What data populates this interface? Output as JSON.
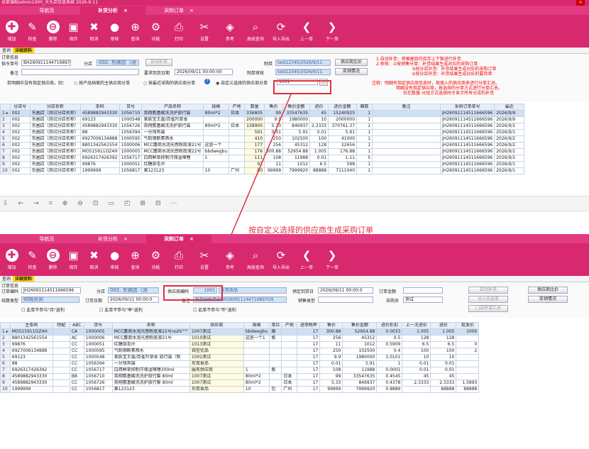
{
  "top": {
    "title": "总部课程admin1000_大头店信息系统 2026-9-11",
    "tabs": [
      {
        "label": "导航页"
      },
      {
        "label": "补货分析"
      },
      {
        "label": "采购订单"
      }
    ],
    "toolbar": [
      "增加",
      "检查",
      "删除",
      "保存",
      "取消",
      "审核",
      "查询",
      "功能",
      "打印",
      "设置",
      "参考",
      "高级查询",
      "导入导出",
      "上一单",
      "下一单"
    ],
    "subtabs": [
      "查询",
      "详细资料"
    ],
    "section": "订单信息",
    "order_no_label": "指令单号",
    "order_no": "BH260911144716897O9",
    "branch_label": "分店",
    "branch": "002. 东圃店（测",
    "auto_btn": "自动补货",
    "maker_label": "制单",
    "maker": "test12345/2026/9/11",
    "compare_btn": "供应商比价",
    "remark_label": "备注",
    "due_label": "要求到货日期",
    "due": "2026/09/11 00:00:00",
    "auditor_label": "制单审核",
    "auditor": "test12345/2026/9/11",
    "stock_btn": "库销情况",
    "question": "若明细中没有指定供应商，则：",
    "opt1": "按产品档案的主供应商分单",
    "opt2": "按最近采购的供应商分单",
    "opt3": "自定义选择的供应商分单",
    "supplier_code": "1001",
    "notes": [
      "1.自动补货：将根据目的库存上下限进行补货",
      "2.审核：①按销售分单：补货结果生成对应的采购订单",
      "③按分店补货：补货结果生成对应的采购订单",
      "④按分店补货：补货结果生成对应的要货单"
    ],
    "notes2": [
      "注释：明细有指定供应商信息时，按填入的供应商来进行分单汇总。",
      "明细没有指定供应商，按选择的分单方式进行分单汇总。",
      "仅在数量-分组方式选择时才显示所有分店的补货"
    ],
    "columns": [
      "分店号",
      "分店名称",
      "条码",
      "货号",
      "产品名称",
      "规格",
      "产地",
      "数量",
      "售价",
      "售价金额",
      "进价",
      "进价金额",
      "箱数",
      "备注",
      "采购订单单号",
      "最近"
    ],
    "rows": [
      [
        "002",
        "东圃店（测试分店名称）",
        "4589882943330",
        "1056710",
        "英翔氨基酸洗洗护旅行装",
        "80ml*2",
        "日本",
        "336805",
        "99",
        "33547635",
        "45",
        "15240925",
        "1",
        "",
        "JH260911145116665​96",
        "2026/9/9"
      ],
      [
        "002",
        "东圃店（测试分店名称）",
        "69123",
        "1000548",
        "美肤宝王露/百雀羚草本",
        "",
        "",
        "200000",
        "9.9",
        "1980000",
        "10",
        "2000000",
        "1",
        "",
        "JH260911145116665​96",
        "2026/9/9"
      ],
      [
        "002",
        "东圃店（测试分店名称）",
        "4589882943330",
        "1056726",
        "英翔氨基酸洗洗护旅行装",
        "80ml*2",
        "日本",
        "158900",
        "5.33",
        "846937",
        "2.3333",
        "370761.37",
        "1",
        "",
        "JH260911145116665​96",
        "2026/9/1"
      ],
      [
        "002",
        "东圃店（测试分店名称）",
        "88",
        "1056394",
        "一分钱有属",
        "",
        "",
        "591",
        "0.01",
        "5.91",
        "0.01",
        "5.91",
        "1",
        "",
        "JH260911145116665​96",
        "2026/9/1"
      ],
      [
        "002",
        "东圃店（测试分店名称）",
        "6927006134888",
        "1000595",
        "气韵钢断素燕水",
        "",
        "",
        "410",
        "250",
        "102500",
        "100",
        "41000",
        "1",
        "",
        "JH260911145116665​96",
        "2026/9/2"
      ],
      [
        "002",
        "东圃店（测试分店名称）",
        "8801342561554",
        "1000006",
        "MCC麋商水润光感粉底液21号",
        "这是一个",
        "",
        "177",
        "256",
        "45312",
        "128",
        "22656",
        "1",
        "",
        "JH260911145116665​96",
        "2026/9/2"
      ],
      [
        "002",
        "东圃店（测试分店名称）",
        "MO515911OZ4H",
        "1000005",
        "MCC麋商水润光感粉底液22号",
        "bbdwegbu",
        "",
        "176",
        "300.88",
        "52954.88",
        "1.005",
        "176.88",
        "1",
        "",
        "JH260911145116665​96",
        "2026/9/1"
      ],
      [
        "002",
        "东圃店（测试分店名称）",
        "6926317426392",
        "1056717",
        "白西鲜草抑制汗保湿啫喱",
        "1",
        "",
        "111",
        "108",
        "11988",
        "0.01",
        "1.11",
        "5",
        "",
        "JH260911145116665​96",
        "2026/9/1"
      ],
      [
        "002",
        "东圃店（测试分店名称）",
        "99876",
        "1000051",
        "红糖蒜毛巾",
        "",
        "",
        "92",
        "11",
        "1012",
        "6.5",
        "598",
        "1",
        "",
        "JH260911145116665​96",
        "2026/9/1"
      ],
      [
        "002",
        "东圃店（测试分店名称）",
        "1999999",
        "1056817",
        "果123123",
        "10",
        "广州",
        "80",
        "99999",
        "7999920",
        "88888",
        "7111040",
        "1",
        "",
        "JH260911145116665​96",
        "2026/9/1"
      ]
    ],
    "midbar": [
      "⇩",
      "←",
      "→",
      "⌗",
      "⊕",
      "⊖",
      "⊡",
      "▭",
      "◰",
      "⊞",
      "⊟",
      "⋯"
    ],
    "caption": "按自定义选择的供应商生成采购订单"
  },
  "bottom": {
    "tabs": [
      {
        "label": "导航页"
      },
      {
        "label": "补货分析"
      },
      {
        "label": "采购订单"
      }
    ],
    "subtabs": [
      "查询",
      "详细资料"
    ],
    "section": "订单信息",
    "po_label": "订单编码",
    "po": "JH2609111451166659​6",
    "branch_label": "分店",
    "branch": "002. 东圃店（测",
    "sup_label": "供应商编码",
    "sup_code": "1001",
    "sup_name": "东莞食品",
    "arrive_label": "预定到货日",
    "arrive": "2026/09/11 00:00:0",
    "amount_label": "订单金额",
    "auto_btn": "自动补货",
    "compare_btn": "供应商比价",
    "settle_label": "结算类型",
    "settle": "购销货到",
    "date_label": "订货日期",
    "date": "2026/09/11 00:00:0",
    "remark_label": "备注",
    "remark": "补货分析单号BH260911144716897O9",
    "saletype_label": "销售类型",
    "buyer_label": "采购员",
    "buyer": "测试",
    "import_btn": "导入托运单",
    "stock_btn": "库销情况",
    "sum_btn": "门店申请汇总",
    "chk1": "此单不参与\"月\"返利",
    "chk2": "此单不参与\"季\"返利",
    "chk3": "此单不参与\"年\"返利",
    "columns": [
      "主条码",
      "特配",
      "ABC",
      "货号",
      "名称",
      "供应商",
      "规格",
      "单位",
      "产地",
      "进项税率",
      "售价",
      "售价金额",
      "进价折扣",
      "上一次进价",
      "进价",
      "批发价"
    ],
    "rows": [
      [
        "MO515911OZ4H",
        "",
        "CA",
        "1000005",
        "MCC麋商水润光感粉底液22号rezhi\"\"\"",
        "1007测试",
        "bbdwegbu",
        "箱",
        "",
        "17",
        "300.88",
        "52954.88",
        "0.0033",
        "1.005",
        "1.005",
        "1000"
      ],
      [
        "8801342561554",
        "",
        "AC",
        "1000006",
        "MCC麋商水润光感粉底液21号",
        "1010测试",
        "这是一个1",
        "瓶",
        "",
        "17",
        "256",
        "45312",
        "0.5",
        "128",
        "128",
        ""
      ],
      [
        "99876",
        "",
        "CC",
        "1000051",
        "红糖蒜毛巾",
        "1013测试",
        "",
        "",
        "",
        "17",
        "11",
        "1012",
        "0.5909",
        "6.5",
        "6.5",
        "0"
      ],
      [
        "6927006134888",
        "",
        "CC",
        "1000595",
        "气韵钢断素燕水",
        "钼宜优品",
        "",
        "",
        "",
        "17",
        "250",
        "102500",
        "0.4",
        "100",
        "100",
        "2"
      ],
      [
        "69123",
        "",
        "CC",
        "1000548",
        "美肤宝王露/百雀羚草本 旅行装（新",
        "1002测试",
        "",
        "",
        "",
        "17",
        "9.9",
        "1980000",
        "1.0101",
        "10",
        "10",
        ""
      ],
      [
        "88",
        "",
        "CC",
        "1056394",
        "一分钱有属",
        "东莞食品",
        "",
        "",
        "",
        "17",
        "0.01",
        "5.91",
        "1",
        "0.01",
        "0.01",
        ""
      ],
      [
        "6926317426392",
        "",
        "CC",
        "1056717",
        "白西鲜草抑制汗保湿啫喱300ml",
        "服务供应商",
        "1",
        "瓶",
        "",
        "17",
        "108",
        "11988",
        "0.0001",
        "0.01",
        "0.01",
        ""
      ],
      [
        "4589882943330",
        "",
        "BB",
        "1056710",
        "英翔氨基酸洗洗护旅行套 80ml",
        "1007测试",
        "80ml*2",
        "",
        "日本",
        "17",
        "99",
        "33547635",
        "0.4545",
        "45",
        "45",
        ""
      ],
      [
        "4589882943330",
        "",
        "CC",
        "1056726",
        "英翔氨基酸洗洗护旅行套 80ml",
        "1007测试",
        "80ml*2",
        "",
        "日本",
        "17",
        "5.33",
        "846937",
        "0.4378",
        "2.3333",
        "2.3333",
        "1.5893"
      ],
      [
        "1999999",
        "",
        "CC",
        "1056817",
        "果123123",
        "东莞食品",
        "10",
        "包",
        "广州",
        "17",
        "99999",
        "7999920",
        "0.8889",
        "",
        "88888",
        "88888"
      ]
    ]
  }
}
